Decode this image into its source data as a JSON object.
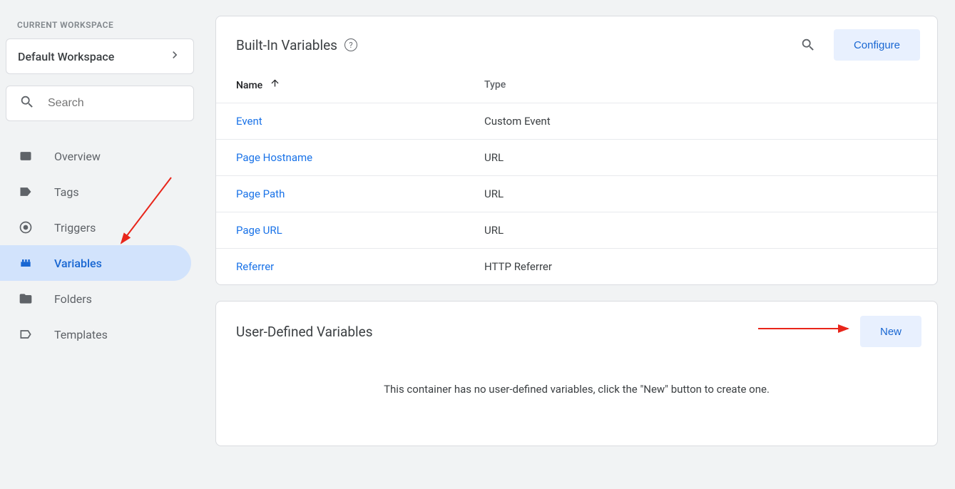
{
  "sidebar": {
    "workspace_label": "CURRENT WORKSPACE",
    "workspace_name": "Default Workspace",
    "search_placeholder": "Search",
    "items": [
      {
        "label": "Overview"
      },
      {
        "label": "Tags"
      },
      {
        "label": "Triggers"
      },
      {
        "label": "Variables"
      },
      {
        "label": "Folders"
      },
      {
        "label": "Templates"
      }
    ]
  },
  "builtin": {
    "title": "Built-In Variables",
    "configure_label": "Configure",
    "columns": {
      "name": "Name",
      "type": "Type"
    },
    "rows": [
      {
        "name": "Event",
        "type": "Custom Event"
      },
      {
        "name": "Page Hostname",
        "type": "URL"
      },
      {
        "name": "Page Path",
        "type": "URL"
      },
      {
        "name": "Page URL",
        "type": "URL"
      },
      {
        "name": "Referrer",
        "type": "HTTP Referrer"
      }
    ]
  },
  "udv": {
    "title": "User-Defined Variables",
    "new_label": "New",
    "empty_text": "This container has no user-defined variables, click the \"New\" button to create one."
  }
}
